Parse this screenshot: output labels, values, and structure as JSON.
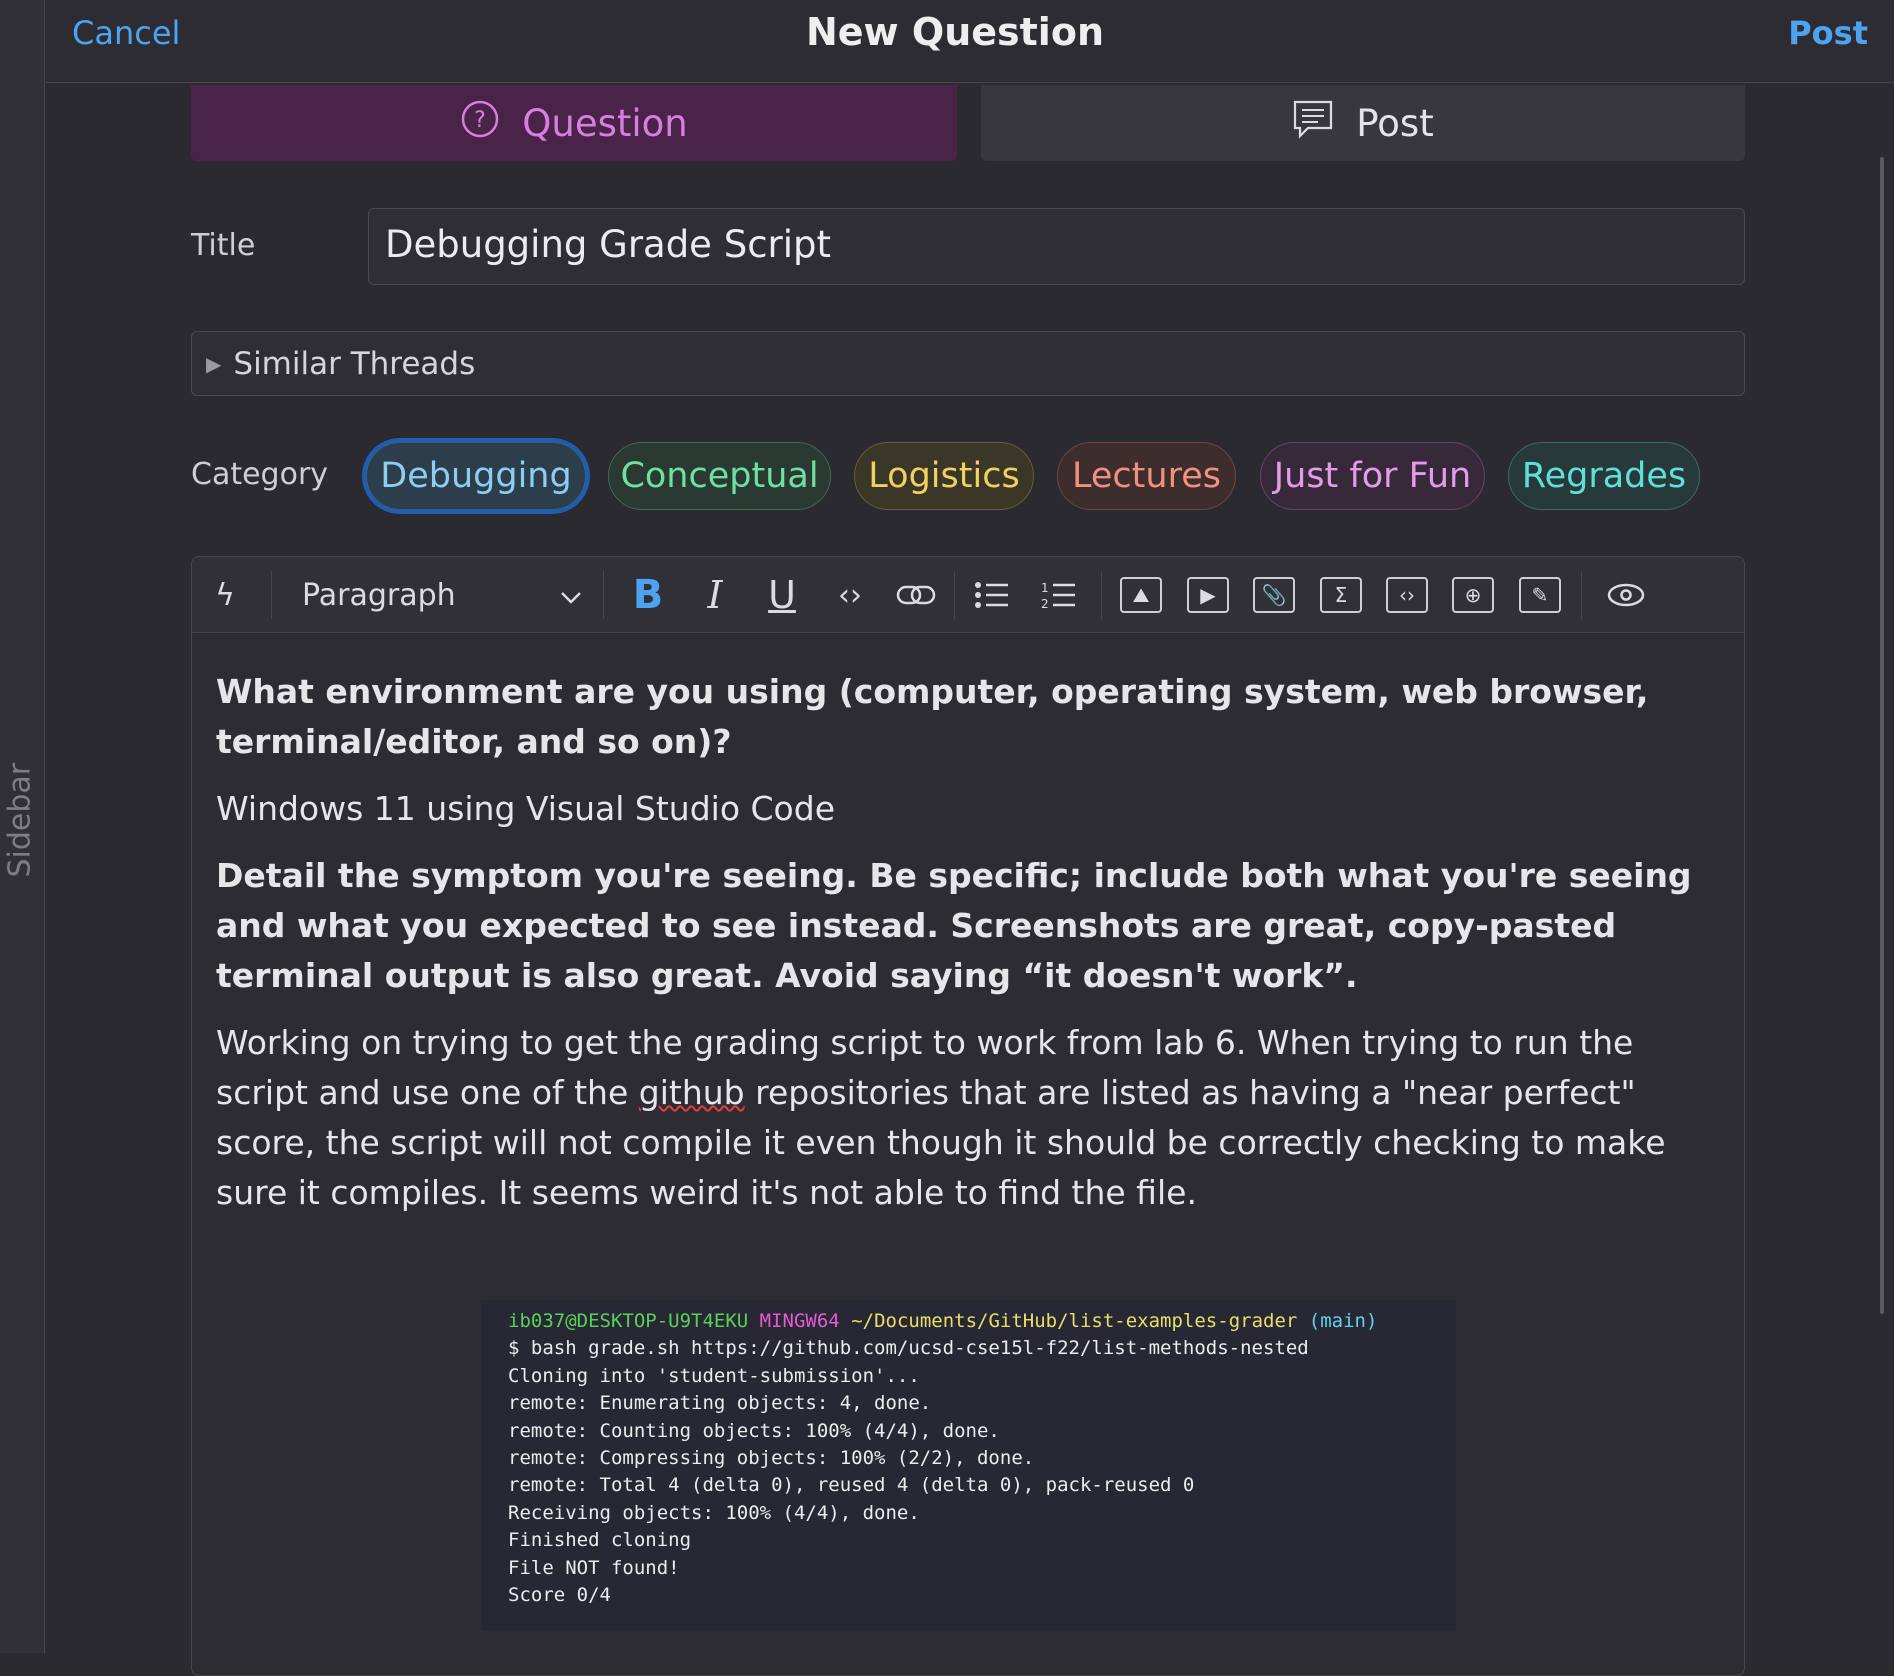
{
  "sidebar": {
    "label": "Sidebar"
  },
  "header": {
    "cancel": "Cancel",
    "title": "New Question",
    "post": "Post"
  },
  "tabs": [
    {
      "label": "Question",
      "icon": "question-circle-icon",
      "active": true
    },
    {
      "label": "Post",
      "icon": "comment-lines-icon",
      "active": false
    }
  ],
  "title": {
    "label": "Title",
    "value": "Debugging Grade Script"
  },
  "similar": {
    "label": "Similar Threads"
  },
  "category": {
    "label": "Category",
    "selected": "Debugging",
    "items": [
      {
        "label": "Debugging",
        "color": "#8ecdf0"
      },
      {
        "label": "Conceptual",
        "color": "#6ee0a0"
      },
      {
        "label": "Logistics",
        "color": "#f0d060"
      },
      {
        "label": "Lectures",
        "color": "#f09080"
      },
      {
        "label": "Just for Fun",
        "color": "#e29ce8"
      },
      {
        "label": "Regrades",
        "color": "#5ee0d8"
      }
    ]
  },
  "toolbar": {
    "format": "Paragraph",
    "bold": "B",
    "italic": "I",
    "underline": "U"
  },
  "body": {
    "q1": "What environment are you using (computer, operating system, web browser, terminal/editor, and so on)?",
    "a1": "Windows 11 using Visual Studio Code",
    "q2": "Detail the symptom you're seeing. Be specific; include both what you're seeing and what you expected to see instead. Screenshots are great, copy-pasted terminal output is also great. Avoid saying “it doesn't work”.",
    "a2_pre": "Working on trying to get the grading script to work from lab 6. When trying to run the script and use one of the ",
    "a2_spell": "github",
    "a2_post": " repositories that are listed as having a \"near perfect\" score, the script will not compile it even though it should be correctly checking to make sure it compiles. It seems weird it's not able to find the file."
  },
  "terminal": {
    "user": "ib037@DESKTOP-U9T4EKU",
    "shell": "MINGW64",
    "path": "~/Documents/GitHub/list-examples-grader",
    "branch": "(main)",
    "lines": [
      "$ bash grade.sh https://github.com/ucsd-cse15l-f22/list-methods-nested",
      "Cloning into 'student-submission'...",
      "remote: Enumerating objects: 4, done.",
      "remote: Counting objects: 100% (4/4), done.",
      "remote: Compressing objects: 100% (2/2), done.",
      "remote: Total 4 (delta 0), reused 4 (delta 0), pack-reused 0",
      "Receiving objects: 100% (4/4), done.",
      "Finished cloning",
      "File NOT found!",
      "Score 0/4"
    ]
  }
}
